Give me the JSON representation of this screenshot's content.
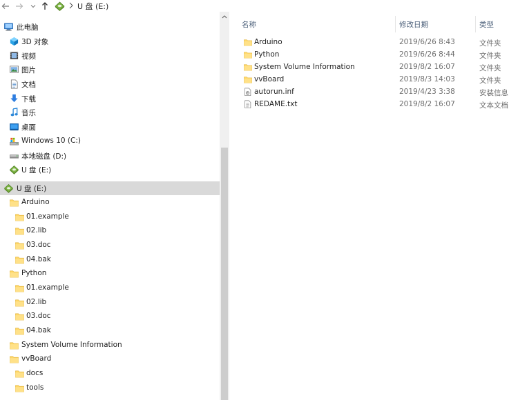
{
  "address_bar": {
    "back_icon": "arrow-left-icon",
    "forward_icon": "arrow-right-icon",
    "up_icon": "arrow-up-icon",
    "location_icon": "usb-drive-icon",
    "location": "U 盘 (E:)"
  },
  "nav_pane": {
    "items": [
      {
        "label": "此电脑",
        "icon": "computer-icon"
      },
      {
        "label": "3D 对象",
        "icon": "3d-objects-icon"
      },
      {
        "label": "视频",
        "icon": "videos-icon"
      },
      {
        "label": "图片",
        "icon": "pictures-icon"
      },
      {
        "label": "文档",
        "icon": "documents-icon"
      },
      {
        "label": "下载",
        "icon": "downloads-icon"
      },
      {
        "label": "音乐",
        "icon": "music-icon"
      },
      {
        "label": "桌面",
        "icon": "desktop-icon"
      },
      {
        "label": "Windows 10 (C:)",
        "icon": "system-drive-icon"
      },
      {
        "label": "本地磁盘 (D:)",
        "icon": "local-disk-icon"
      },
      {
        "label": "U 盘 (E:)",
        "icon": "usb-drive-icon"
      },
      {
        "label": "U 盘 (E:)",
        "icon": "usb-drive-icon",
        "selected": true
      },
      {
        "label": "Arduino",
        "icon": "folder-icon"
      },
      {
        "label": "01.example",
        "icon": "folder-icon"
      },
      {
        "label": "02.lib",
        "icon": "folder-icon"
      },
      {
        "label": "03.doc",
        "icon": "folder-icon"
      },
      {
        "label": "04.bak",
        "icon": "folder-icon"
      },
      {
        "label": "Python",
        "icon": "folder-icon"
      },
      {
        "label": "01.example",
        "icon": "folder-icon"
      },
      {
        "label": "02.lib",
        "icon": "folder-icon"
      },
      {
        "label": "03.doc",
        "icon": "folder-icon"
      },
      {
        "label": "04.bak",
        "icon": "folder-icon"
      },
      {
        "label": "System Volume Information",
        "icon": "folder-icon"
      },
      {
        "label": "vvBoard",
        "icon": "folder-icon"
      },
      {
        "label": "docs",
        "icon": "folder-icon"
      },
      {
        "label": "tools",
        "icon": "folder-icon"
      }
    ]
  },
  "file_list": {
    "columns": {
      "name": "名称",
      "date": "修改日期",
      "type": "类型"
    },
    "rows": [
      {
        "name": "Arduino",
        "date": "2019/6/26 8:43",
        "type": "文件夹",
        "icon": "folder-icon"
      },
      {
        "name": "Python",
        "date": "2019/6/26 8:44",
        "type": "文件夹",
        "icon": "folder-icon"
      },
      {
        "name": "System Volume Information",
        "date": "2019/8/2 16:07",
        "type": "文件夹",
        "icon": "folder-icon"
      },
      {
        "name": "vvBoard",
        "date": "2019/8/3 14:03",
        "type": "文件夹",
        "icon": "folder-icon"
      },
      {
        "name": "autorun.inf",
        "date": "2019/4/23 3:38",
        "type": "安装信息",
        "icon": "settings-file-icon"
      },
      {
        "name": "REDAME.txt",
        "date": "2019/8/2 16:07",
        "type": "文本文档",
        "icon": "text-file-icon"
      }
    ]
  },
  "colors": {
    "selection": "#d9d9d9",
    "folder": "#ffd767",
    "header_text": "#4c607a",
    "scroll_thumb": "#cdcdcd"
  }
}
